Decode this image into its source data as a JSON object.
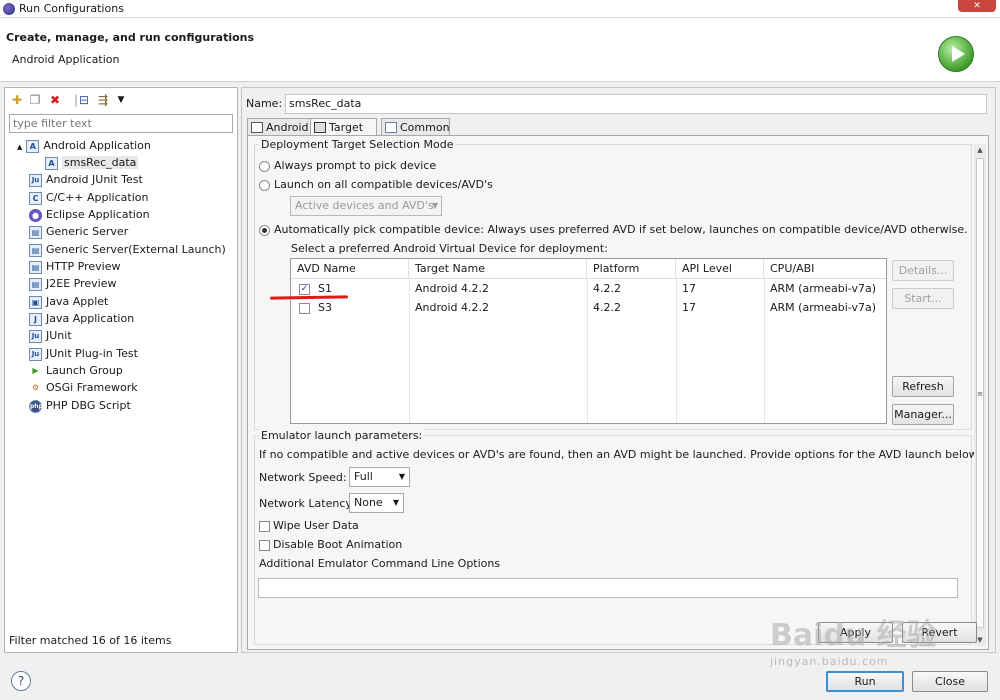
{
  "window": {
    "title": "Run Configurations",
    "close_glyph": "✕"
  },
  "header": {
    "title": "Create, manage, and run configurations",
    "subtitle": "Android Application"
  },
  "left": {
    "filter_placeholder": "type filter text",
    "toolbar_icons": [
      "new-config-icon",
      "duplicate-icon",
      "delete-icon",
      "collapse-all-icon",
      "filter-icon"
    ],
    "tree": [
      {
        "label": "Android Application",
        "icon": "android-app-icon",
        "icon_text": "A",
        "expanded": true,
        "expander": "▲"
      },
      {
        "label": "smsRec_data",
        "icon": "android-config-icon",
        "icon_text": "A",
        "selected": true
      },
      {
        "label": "Android JUnit Test",
        "icon": "junit-icon",
        "icon_text": "Ju"
      },
      {
        "label": "C/C++ Application",
        "icon": "c-app-icon",
        "icon_text": "C"
      },
      {
        "label": "Eclipse Application",
        "icon": "eclipse-icon",
        "icon_text": "●"
      },
      {
        "label": "Generic Server",
        "icon": "server-icon",
        "icon_text": "▤"
      },
      {
        "label": "Generic Server(External Launch)",
        "icon": "server-icon",
        "icon_text": "▤"
      },
      {
        "label": "HTTP Preview",
        "icon": "http-icon",
        "icon_text": "▤"
      },
      {
        "label": "J2EE Preview",
        "icon": "j2ee-icon",
        "icon_text": "▤"
      },
      {
        "label": "Java Applet",
        "icon": "applet-icon",
        "icon_text": "▣"
      },
      {
        "label": "Java Application",
        "icon": "java-app-icon",
        "icon_text": "J"
      },
      {
        "label": "JUnit",
        "icon": "junit-icon",
        "icon_text": "Ju"
      },
      {
        "label": "JUnit Plug-in Test",
        "icon": "junit-plugin-icon",
        "icon_text": "Ju"
      },
      {
        "label": "Launch Group",
        "icon": "launch-group-icon",
        "icon_text": "▶"
      },
      {
        "label": "OSGi Framework",
        "icon": "osgi-icon",
        "icon_text": "⚙"
      },
      {
        "label": "PHP DBG Script",
        "icon": "php-icon",
        "icon_text": "php"
      }
    ],
    "filter_status": "Filter matched 16 of 16 items"
  },
  "right": {
    "name_label": "Name:",
    "name_value": "smsRec_data",
    "tabs": [
      {
        "label": "Android",
        "icon": "android-tab-icon"
      },
      {
        "label": "Target",
        "icon": "target-tab-icon",
        "active": true
      },
      {
        "label": "Common",
        "icon": "common-tab-icon"
      }
    ],
    "deployment": {
      "group_label": "Deployment Target Selection Mode",
      "opt_prompt": "Always prompt to pick device",
      "opt_launch_all": "Launch on all compatible devices/AVD's",
      "launch_all_combo": "Active devices and AVD's",
      "opt_auto": "Automatically pick compatible device: Always uses preferred AVD if set below, launches on compatible device/AVD otherwise.",
      "select_label": "Select a preferred Android Virtual Device for deployment:",
      "columns": [
        "AVD Name",
        "Target Name",
        "Platform",
        "API Level",
        "CPU/ABI"
      ],
      "rows": [
        {
          "checked": true,
          "check_glyph": "✓",
          "avd": "S1",
          "target": "Android 4.2.2",
          "platform": "4.2.2",
          "api": "17",
          "cpu": "ARM (armeabi-v7a)"
        },
        {
          "checked": false,
          "check_glyph": "",
          "avd": "S3",
          "target": "Android 4.2.2",
          "platform": "4.2.2",
          "api": "17",
          "cpu": "ARM (armeabi-v7a)"
        }
      ],
      "buttons": {
        "details": "Details...",
        "start": "Start...",
        "refresh": "Refresh",
        "manager": "Manager..."
      }
    },
    "emulator": {
      "group_label": "Emulator launch parameters:",
      "info": "If no compatible and active devices or AVD's are found, then an AVD might be launched. Provide options for the AVD launch below.",
      "speed_label": "Network Speed:",
      "speed_value": "Full",
      "latency_label": "Network Latency:",
      "latency_value": "None",
      "wipe_label": "Wipe User Data",
      "boot_anim_label": "Disable Boot Animation",
      "cmdline_label": "Additional Emulator Command Line Options",
      "cmdline_value": ""
    },
    "apply_label": "Apply",
    "revert_label": "Revert"
  },
  "footer": {
    "help_glyph": "?",
    "run_label": "Run",
    "close_label": "Close"
  },
  "watermark": {
    "text": "Baidu 经验",
    "url": "jingyan.baidu.com"
  },
  "colors": {
    "accent": "#3a8fd6",
    "run_green": "#3e9d2a",
    "annotation_red": "#e31818"
  }
}
